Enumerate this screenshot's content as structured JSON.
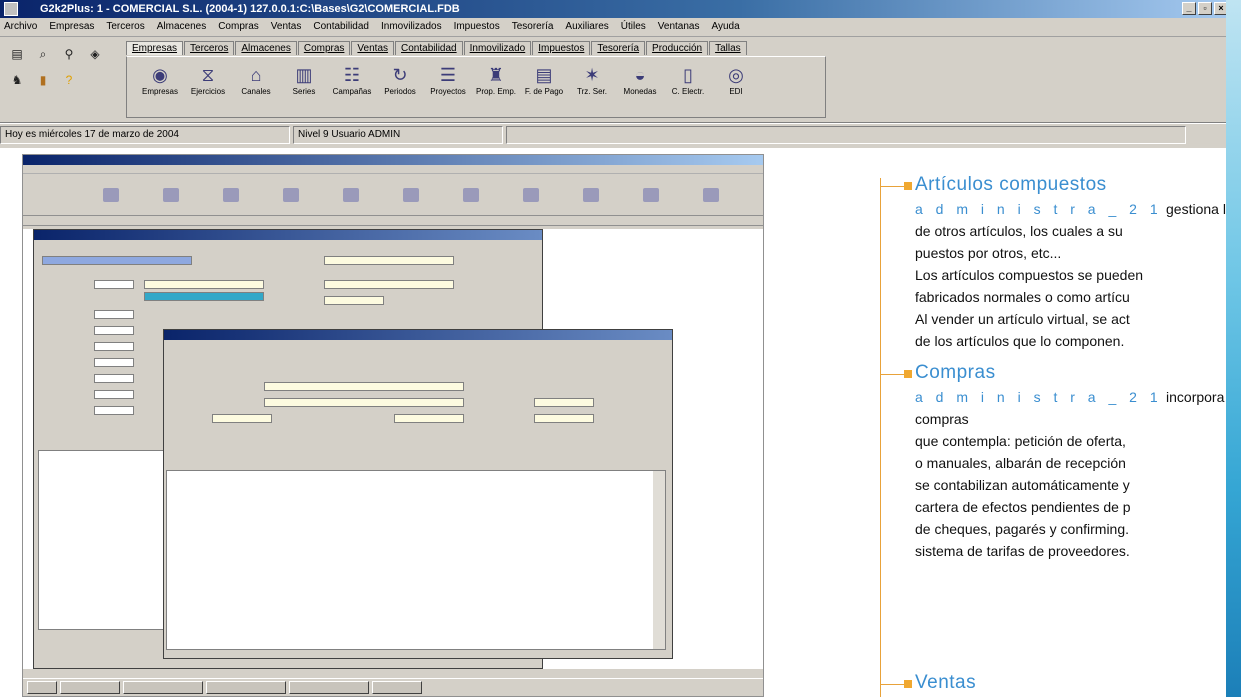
{
  "window": {
    "title": "G2k2Plus: 1 - COMERCIAL S.L. (2004-1) 127.0.0.1:C:\\Bases\\G2\\COMERCIAL.FDB",
    "controls": [
      "_",
      "▫",
      "×"
    ]
  },
  "menu": [
    "Archivo",
    "Empresas",
    "Terceros",
    "Almacenes",
    "Compras",
    "Ventas",
    "Contabilidad",
    "Inmovilizados",
    "Impuestos",
    "Tesorería",
    "Auxiliares",
    "Útiles",
    "Ventanas",
    "Ayuda"
  ],
  "toolbar_small_icons": [
    "print-icon",
    "preview-icon",
    "search-icon",
    "zoom-icon",
    "users-icon",
    "book-icon",
    "help-icon"
  ],
  "module_tabs": [
    "Empresas",
    "Terceros",
    "Almacenes",
    "Compras",
    "Ventas",
    "Contabilidad",
    "Inmovilizado",
    "Impuestos",
    "Tesorería",
    "Producción",
    "Tallas"
  ],
  "active_tab": "Empresas",
  "empresa_buttons": [
    {
      "label": "Empresas",
      "glyph": "◉"
    },
    {
      "label": "Ejercicios",
      "glyph": "⧖"
    },
    {
      "label": "Canales",
      "glyph": "⌂"
    },
    {
      "label": "Series",
      "glyph": "▥"
    },
    {
      "label": "Campañas",
      "glyph": "☷"
    },
    {
      "label": "Periodos",
      "glyph": "↻"
    },
    {
      "label": "Proyectos",
      "glyph": "☰"
    },
    {
      "label": "Prop. Emp.",
      "glyph": "♜"
    },
    {
      "label": "F. de Pago",
      "glyph": "▤"
    },
    {
      "label": "Trz. Ser.",
      "glyph": "✶"
    },
    {
      "label": "Monedas",
      "glyph": "◒"
    },
    {
      "label": "C. Electr.",
      "glyph": "▯"
    },
    {
      "label": "EDI",
      "glyph": "◎"
    }
  ],
  "status": {
    "date": "Hoy es miércoles 17 de marzo de 2004",
    "nivel": "Nivel   9   Usuario   ADMIN"
  },
  "panel": {
    "sections": [
      {
        "title": "Artículos compuestos",
        "lines": [
          {
            "brand": "administra_21",
            "text": " gestiona los"
          },
          {
            "brand": "",
            "text": "de otros artículos, los cuales a su"
          },
          {
            "brand": "",
            "text": "puestos por otros, etc..."
          },
          {
            "brand": "",
            "text": "Los artículos compuestos se pueden"
          },
          {
            "brand": "",
            "text": "fabricados normales o como artícu"
          },
          {
            "brand": "",
            "text": "Al vender un artículo virtual, se act"
          },
          {
            "brand": "",
            "text": "de los artículos que lo componen."
          }
        ]
      },
      {
        "title": "Compras",
        "lines": [
          {
            "brand": "administra_21",
            "text": " incorpora u"
          },
          {
            "brand": "",
            "text": "compras"
          },
          {
            "brand": "",
            "text": "que contempla: petición de oferta,"
          },
          {
            "brand": "",
            "text": "o manuales, albarán de recepción"
          },
          {
            "brand": "",
            "text": "se contabilizan automáticamente y"
          },
          {
            "brand": "",
            "text": "cartera de efectos pendientes de p"
          },
          {
            "brand": "",
            "text": "de cheques, pagarés y confirming."
          },
          {
            "brand": "",
            "text": "sistema de tarifas de proveedores."
          }
        ]
      },
      {
        "title": "Ventas",
        "lines": []
      }
    ]
  },
  "colors": {
    "accent": "#3a8ed0",
    "rule": "#e8a23a",
    "bullet": "#f0a830"
  }
}
